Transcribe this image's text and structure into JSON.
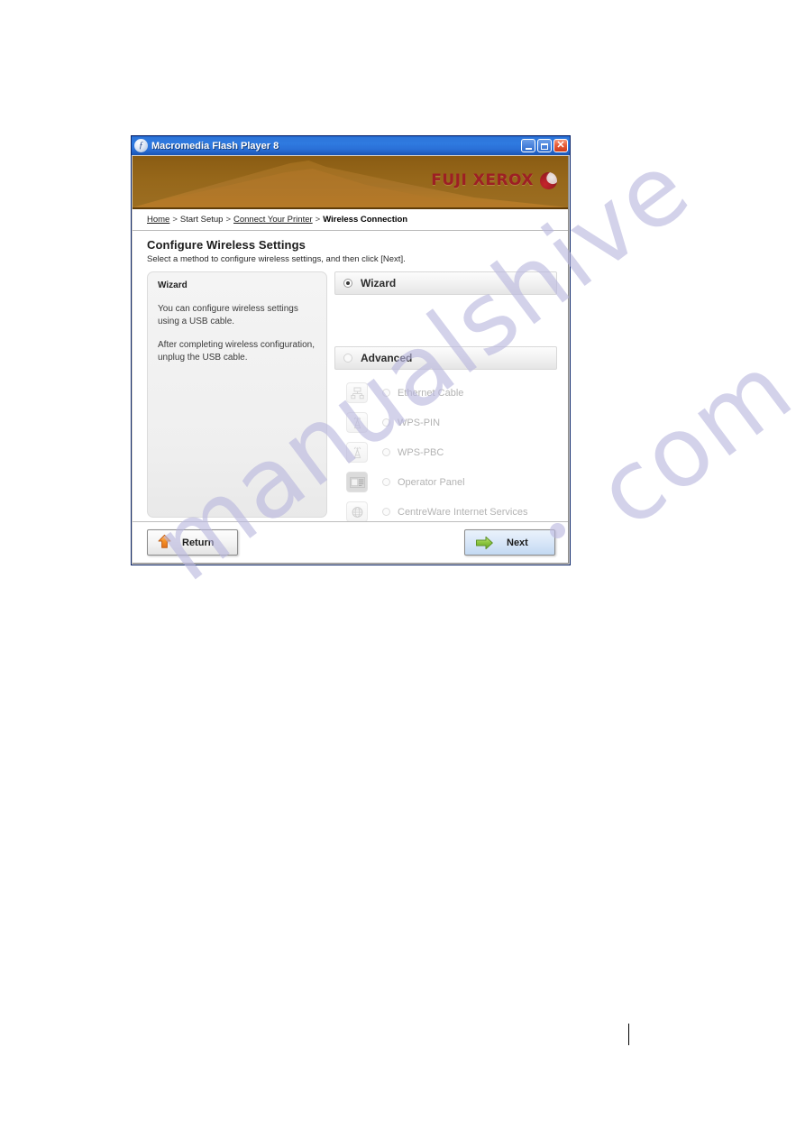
{
  "window": {
    "title": "Macromedia Flash Player 8",
    "app_icon": "flash-icon",
    "controls": {
      "minimize": "minimize-button",
      "maximize": "maximize-button",
      "close": "close-button",
      "close_glyph": "✕"
    }
  },
  "banner": {
    "brand": "FUJI XEROX",
    "logo_icon": "fuji-xerox-sphere-logo",
    "bg_color": "#96671a",
    "brand_color": "#9d1f24"
  },
  "breadcrumb": {
    "separator": ">",
    "items": [
      {
        "label": "Home",
        "style": "link"
      },
      {
        "label": "Start Setup",
        "style": "plain"
      },
      {
        "label": "Connect Your Printer",
        "style": "link"
      },
      {
        "label": "Wireless Connection",
        "style": "current"
      }
    ]
  },
  "page": {
    "title": "Configure Wireless Settings",
    "subtitle": "Select a method to configure wireless settings, and then click [Next]."
  },
  "info_panel": {
    "title": "Wizard",
    "paragraphs": [
      "You can configure wireless settings using a USB cable.",
      "After completing  wireless configuration, unplug the USB cable."
    ]
  },
  "methods": {
    "wizard": {
      "label": "Wizard",
      "selected": true
    },
    "advanced": {
      "label": "Advanced",
      "selected": false
    },
    "advanced_options": [
      {
        "label": "Ethernet Cable",
        "icon": "ethernet-hub-icon",
        "selected": false,
        "disabled": true
      },
      {
        "label": "WPS-PIN",
        "icon": "wireless-antenna-icon",
        "selected": false,
        "disabled": true
      },
      {
        "label": "WPS-PBC",
        "icon": "wireless-antenna-icon",
        "selected": false,
        "disabled": true
      },
      {
        "label": "Operator Panel",
        "icon": "control-panel-icon",
        "selected": false,
        "disabled": true
      },
      {
        "label": "CentreWare Internet Services",
        "icon": "globe-icon",
        "selected": false,
        "disabled": true
      }
    ]
  },
  "footer": {
    "return_label": "Return",
    "return_icon": "orange-up-arrow-icon",
    "next_label": "Next",
    "next_icon": "green-right-arrow-icon"
  },
  "watermark": {
    "text": "manualshive",
    "suffix": "com",
    "color": "#b9b7de"
  }
}
